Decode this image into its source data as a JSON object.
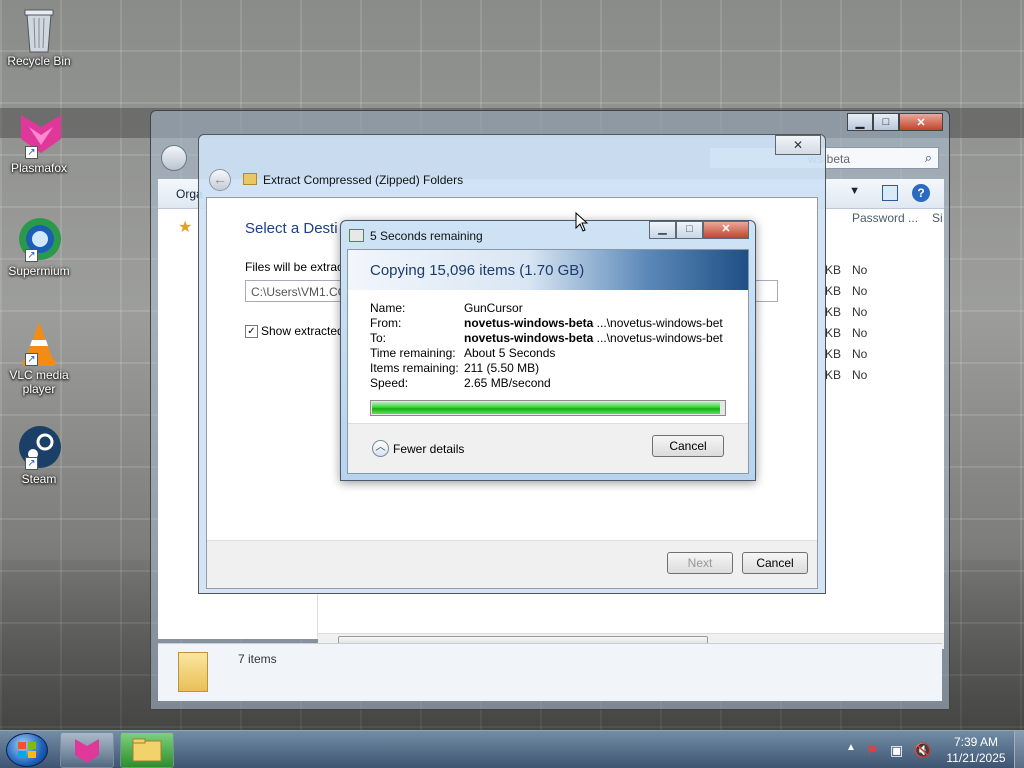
{
  "desktop": {
    "icons": [
      {
        "label": "Recycle Bin"
      },
      {
        "label": "Plasmafox"
      },
      {
        "label": "Supermium"
      },
      {
        "label": "VLC media player"
      },
      {
        "label": "Steam"
      }
    ]
  },
  "explorer": {
    "toolbar_left": "Orga",
    "search_suffix": "ws-beta",
    "columns": {
      "password": "Password ...",
      "size": "Si"
    },
    "rows": [
      {
        "size": "KB",
        "password": "No"
      },
      {
        "size": "KB",
        "password": "No"
      },
      {
        "size": "KB",
        "password": "No"
      },
      {
        "size": "KB",
        "password": "No"
      },
      {
        "size": "KB",
        "password": "No"
      },
      {
        "size": "KB",
        "password": "No"
      }
    ],
    "status": "7 items"
  },
  "wizard": {
    "title": "Extract Compressed (Zipped) Folders",
    "heading": "Select a Desti",
    "files_label": "Files will be extract",
    "path_value": "C:\\Users\\VM1.CC",
    "show_extracted": "Show extracted",
    "next_label": "Next",
    "cancel_label": "Cancel"
  },
  "copy_dialog": {
    "caption": "5 Seconds remaining",
    "header": "Copying 15,096 items (1.70 GB)",
    "details": {
      "name_label": "Name:",
      "name_value": "GunCursor",
      "from_label": "From:",
      "from_bold": "novetus-windows-beta",
      "from_rest": " ...\\novetus-windows-bet",
      "to_label": "To:",
      "to_bold": "novetus-windows-beta",
      "to_rest": " ...\\novetus-windows-bet",
      "time_label": "Time remaining:",
      "time_value": "About 5 Seconds",
      "items_label": "Items remaining:",
      "items_value": "211 (5.50 MB)",
      "speed_label": "Speed:",
      "speed_value": "2.65 MB/second"
    },
    "progress": 0.99,
    "fewer_details": "Fewer details",
    "cancel_label": "Cancel"
  },
  "taskbar": {
    "time": "7:39 AM",
    "date": "11/21/2025"
  }
}
